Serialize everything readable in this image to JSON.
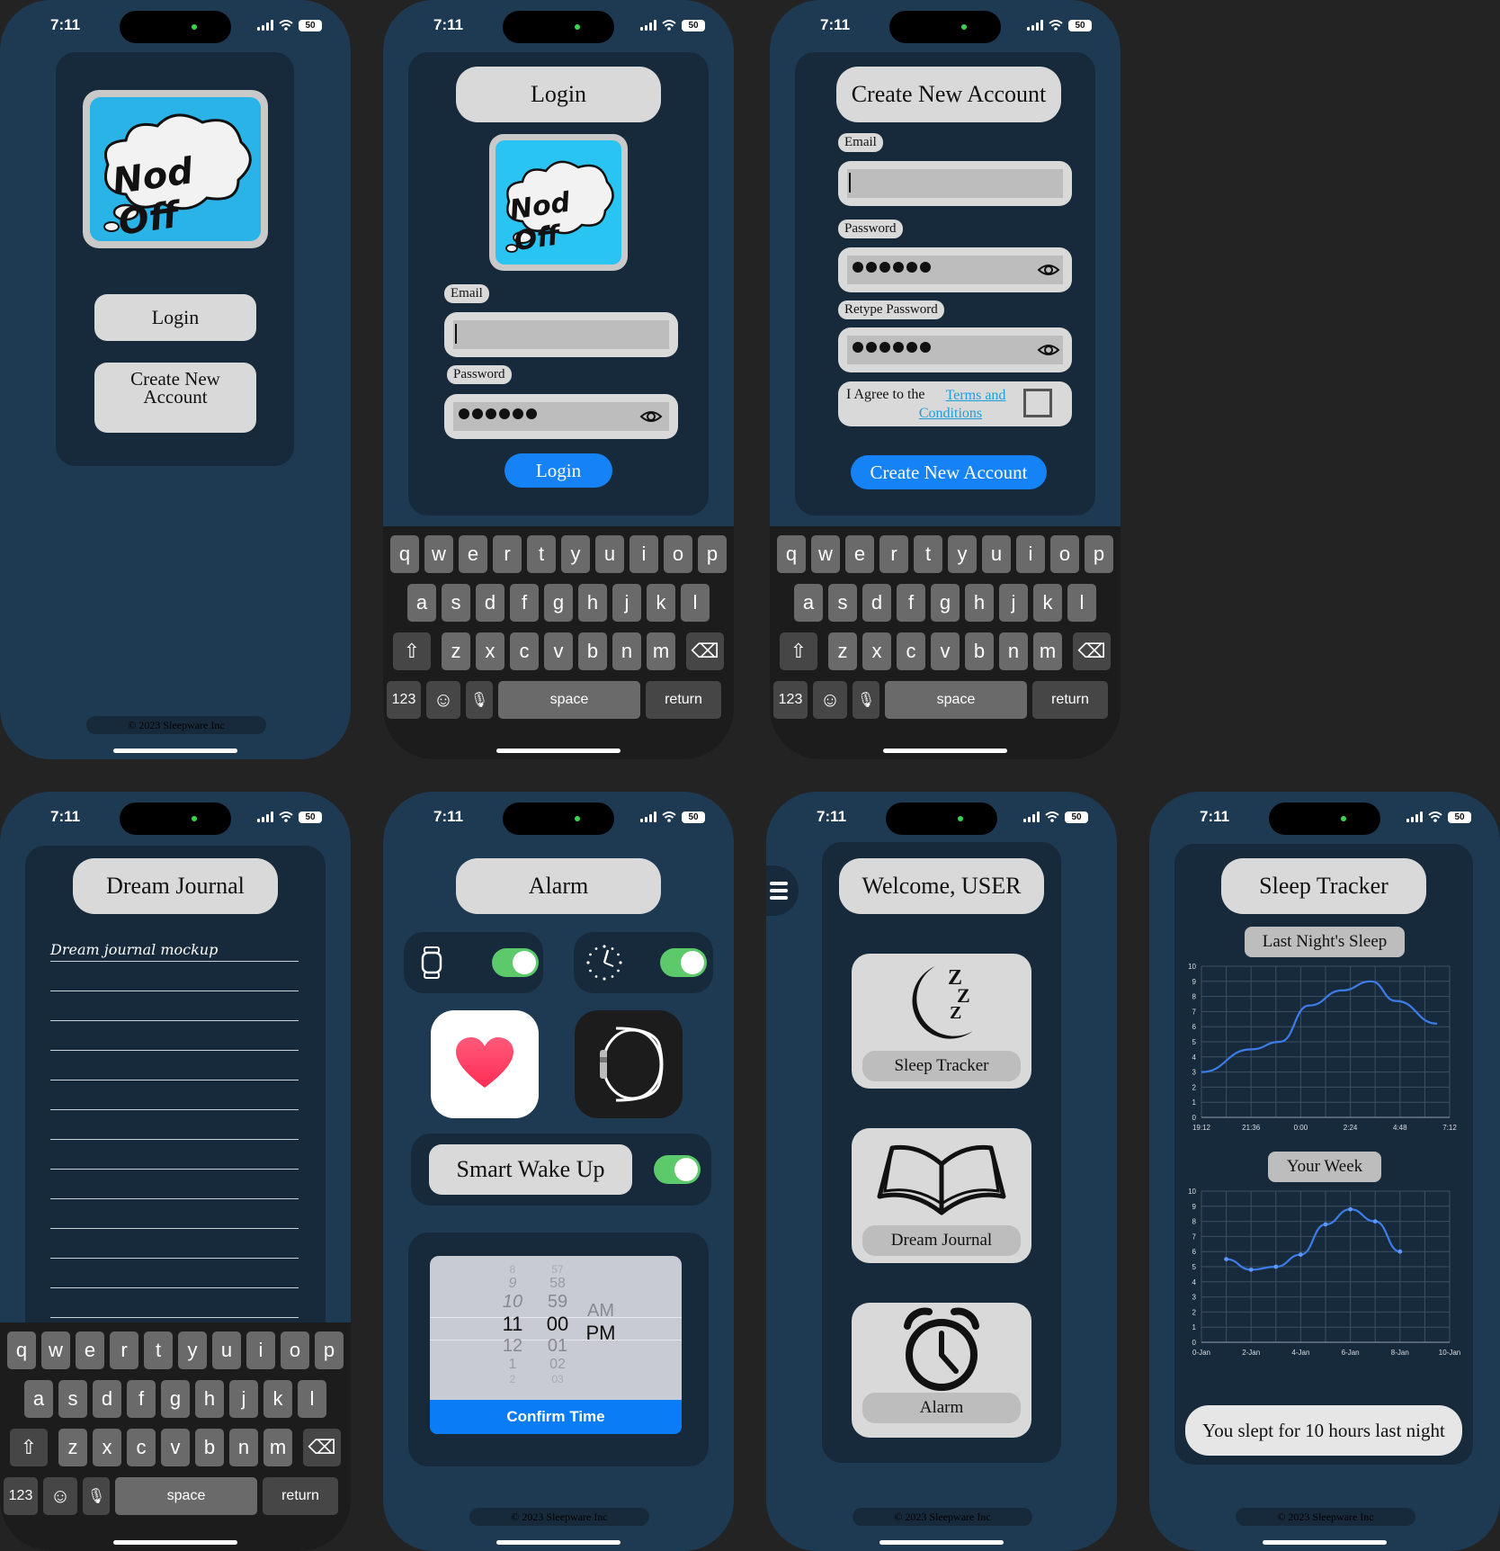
{
  "status": {
    "time": "7:11",
    "battery": "50"
  },
  "splash": {
    "logo_text": "Nod Off",
    "login": "Login",
    "create": "Create New Account",
    "footer": "© 2023 Sleepware Inc"
  },
  "login": {
    "title": "Login",
    "email_label": "Email",
    "password_label": "Password",
    "submit": "Login"
  },
  "signup": {
    "title": "Create New Account",
    "email_label": "Email",
    "password_label": "Password",
    "retype_label": "Retype Password",
    "agree_text": "I Agree to the",
    "terms_link": "Terms and Conditions",
    "submit": "Create New Account"
  },
  "keyboard": {
    "row1": [
      "q",
      "w",
      "e",
      "r",
      "t",
      "y",
      "u",
      "i",
      "o",
      "p"
    ],
    "row2": [
      "a",
      "s",
      "d",
      "f",
      "g",
      "h",
      "j",
      "k",
      "l"
    ],
    "row3": [
      "z",
      "x",
      "c",
      "v",
      "b",
      "n",
      "m"
    ],
    "numbers": "123",
    "space": "space",
    "return": "return"
  },
  "journal": {
    "title": "Dream Journal",
    "text": "Dream journal mockup"
  },
  "alarm": {
    "title": "Alarm",
    "smart_wake": "Smart Wake Up",
    "picker": {
      "hours_above": [
        "8",
        "9",
        "10"
      ],
      "hour": "11",
      "hours_below": [
        "12",
        "1",
        "2"
      ],
      "minutes_above": [
        "57",
        "58",
        "59"
      ],
      "minute": "00",
      "minutes_below": [
        "01",
        "02",
        "03"
      ],
      "ampm_above": "AM",
      "ampm": "PM"
    },
    "confirm": "Confirm Time",
    "footer": "© 2023 Sleepware Inc"
  },
  "home": {
    "title": "Welcome, USER",
    "tiles": [
      "Sleep Tracker",
      "Dream Journal",
      "Alarm"
    ],
    "footer": "© 2023 Sleepware Inc"
  },
  "tracker": {
    "title": "Sleep Tracker",
    "last_night_label": "Last Night's Sleep",
    "week_label": "Your Week",
    "summary": "You slept for 10 hours last night",
    "footer": "© 2023 Sleepware Inc"
  },
  "chart_data": [
    {
      "type": "line",
      "title": "Last Night's Sleep",
      "x": [
        "19:12",
        "21:36",
        "0:00",
        "2:24",
        "4:48",
        "7:12"
      ],
      "series": [
        {
          "x": [
            19.2,
            21.6,
            23.0,
            24.4,
            26.0,
            27.4,
            28.6,
            30.6
          ],
          "values": [
            3.0,
            4.5,
            5.0,
            7.4,
            8.4,
            9.0,
            7.7,
            6.2
          ]
        }
      ],
      "ylim": [
        0,
        10
      ],
      "yticks": [
        0,
        1,
        2,
        3,
        4,
        5,
        6,
        7,
        8,
        9,
        10
      ],
      "grid": true,
      "color": "#3d7dea"
    },
    {
      "type": "line",
      "title": "Your Week",
      "x": [
        "0-Jan",
        "2-Jan",
        "4-Jan",
        "6-Jan",
        "8-Jan",
        "10-Jan"
      ],
      "series": [
        {
          "x": [
            1,
            2,
            3,
            4,
            5,
            6,
            7,
            8
          ],
          "values": [
            5.5,
            4.8,
            5.0,
            5.8,
            7.8,
            8.8,
            8.0,
            6.0
          ]
        }
      ],
      "ylim": [
        0,
        10
      ],
      "yticks": [
        0,
        1,
        2,
        3,
        4,
        5,
        6,
        7,
        8,
        9,
        10
      ],
      "grid": true,
      "color": "#3d7dea"
    }
  ]
}
